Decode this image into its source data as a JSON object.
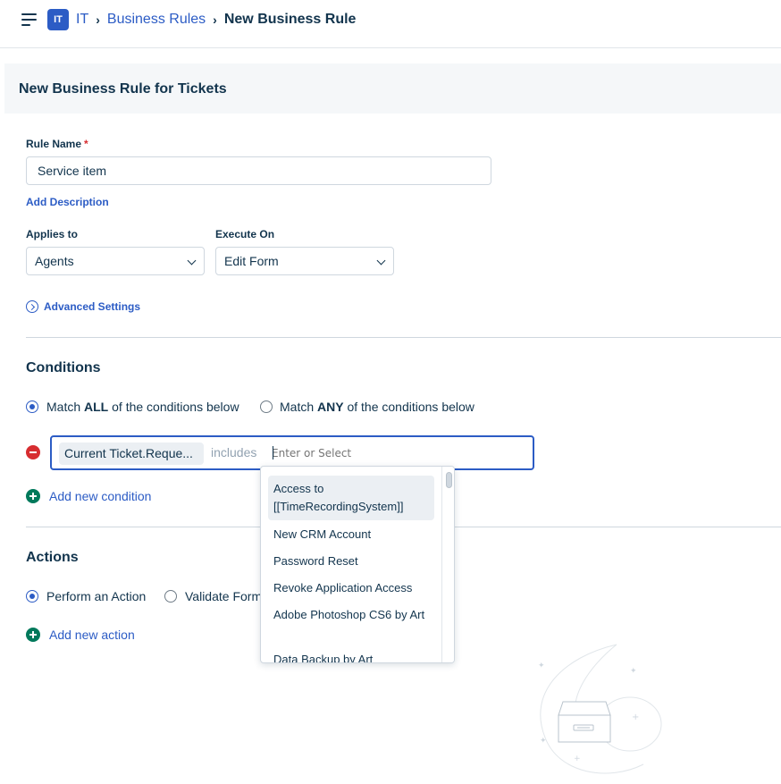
{
  "header": {
    "workspace_badge": "IT",
    "breadcrumb": [
      "IT",
      "Business Rules",
      "New Business Rule"
    ]
  },
  "form": {
    "title": "New Business Rule for Tickets",
    "rule_name_label": "Rule Name",
    "required_mark": "*",
    "rule_name_value": "Service item",
    "add_description": "Add Description",
    "applies_to_label": "Applies to",
    "applies_to_value": "Agents",
    "execute_on_label": "Execute On",
    "execute_on_value": "Edit Form",
    "advanced_settings": "Advanced Settings"
  },
  "conditions": {
    "title": "Conditions",
    "match_all": {
      "prefix": "Match ",
      "keyword": "ALL",
      "suffix": " of the conditions below",
      "selected": true
    },
    "match_any": {
      "prefix": "Match ",
      "keyword": "ANY",
      "suffix": " of the conditions below",
      "selected": false
    },
    "row": {
      "field": "Current Ticket.Reque...",
      "operator": "includes",
      "value_placeholder": "Enter or Select"
    },
    "add_condition": "Add new condition"
  },
  "dropdown": {
    "options": [
      "Access to [[TimeRecordingSystem]]",
      "New CRM Account",
      "Password Reset",
      "Revoke Application Access",
      "Adobe Photoshop CS6 by Art",
      "Data Backup by Art"
    ],
    "highlighted_index": 0
  },
  "actions": {
    "title": "Actions",
    "perform_action": "Perform an Action",
    "validate_form": "Validate Form",
    "add_action": "Add new action"
  },
  "colors": {
    "accent": "#2c5cc5",
    "text": "#12344d",
    "danger": "#d72d30",
    "success": "#00795b"
  }
}
